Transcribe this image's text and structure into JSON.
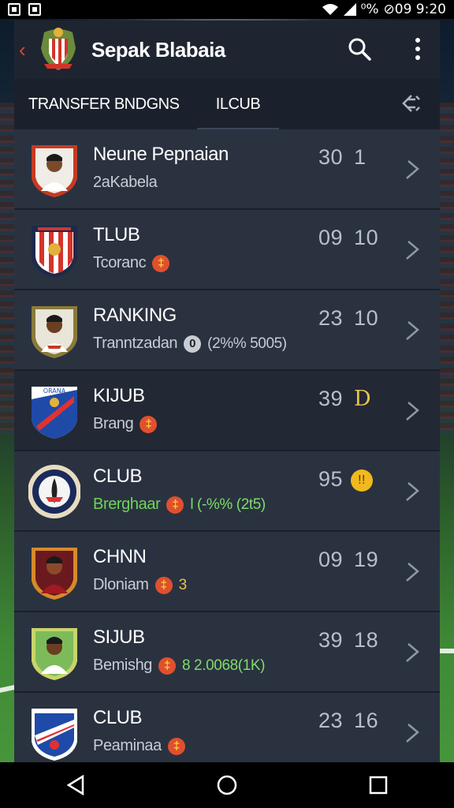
{
  "status_bar": {
    "time": "⊘09 9:20",
    "battery": "⁰%"
  },
  "app": {
    "title": "Sepak Blabaia"
  },
  "tabs": [
    {
      "label": "TRANSFER BNDGNS"
    },
    {
      "label": "ILCUB"
    }
  ],
  "rows": [
    {
      "name": "Neune Pepnaian",
      "sub": "2aKabela",
      "badge": "",
      "extra": "",
      "stat1": "30",
      "stat2": "1",
      "coin": "",
      "crest": "player-red"
    },
    {
      "name": "TLUB",
      "sub": "Tcoranc",
      "badge": "‡",
      "extra": "",
      "stat1": "09",
      "stat2": "10",
      "coin": "",
      "crest": "stripes"
    },
    {
      "name": "RANKING",
      "sub": "Tranntzadan",
      "badge": "0",
      "extra": "(2%% 5005)",
      "stat1": "23",
      "stat2": "10",
      "coin": "",
      "crest": "player-olive"
    },
    {
      "name": "KIJUB",
      "sub": "Brang",
      "badge": "‡",
      "extra": "",
      "stat1": "39",
      "stat2": "D",
      "coin": "",
      "crest": "blue-diagonal"
    },
    {
      "name": "CLUB",
      "sub": "Brerghaar",
      "badge": "‡",
      "extra": "l (-%% (2t5)",
      "stat1": "95",
      "stat2": "",
      "coin": "!!",
      "crest": "round-navy"
    },
    {
      "name": "CHNN",
      "sub": "Dloniam",
      "badge": "‡",
      "extra": "3",
      "stat1": "09",
      "stat2": "19",
      "coin": "",
      "crest": "player-maroon"
    },
    {
      "name": "SIJUB",
      "sub": "Bemishg",
      "badge": "‡",
      "extra": "8 2.0068(1K)",
      "stat1": "39",
      "stat2": "18",
      "coin": "",
      "crest": "player-green"
    },
    {
      "name": "CLUB",
      "sub": "Peaminaa",
      "badge": "‡",
      "extra": "",
      "stat1": "23",
      "stat2": "16",
      "coin": "",
      "crest": "blue-shield"
    }
  ],
  "colors": {
    "accent": "#e0502e",
    "panel": "#232b39",
    "gold": "#f2b91e"
  }
}
